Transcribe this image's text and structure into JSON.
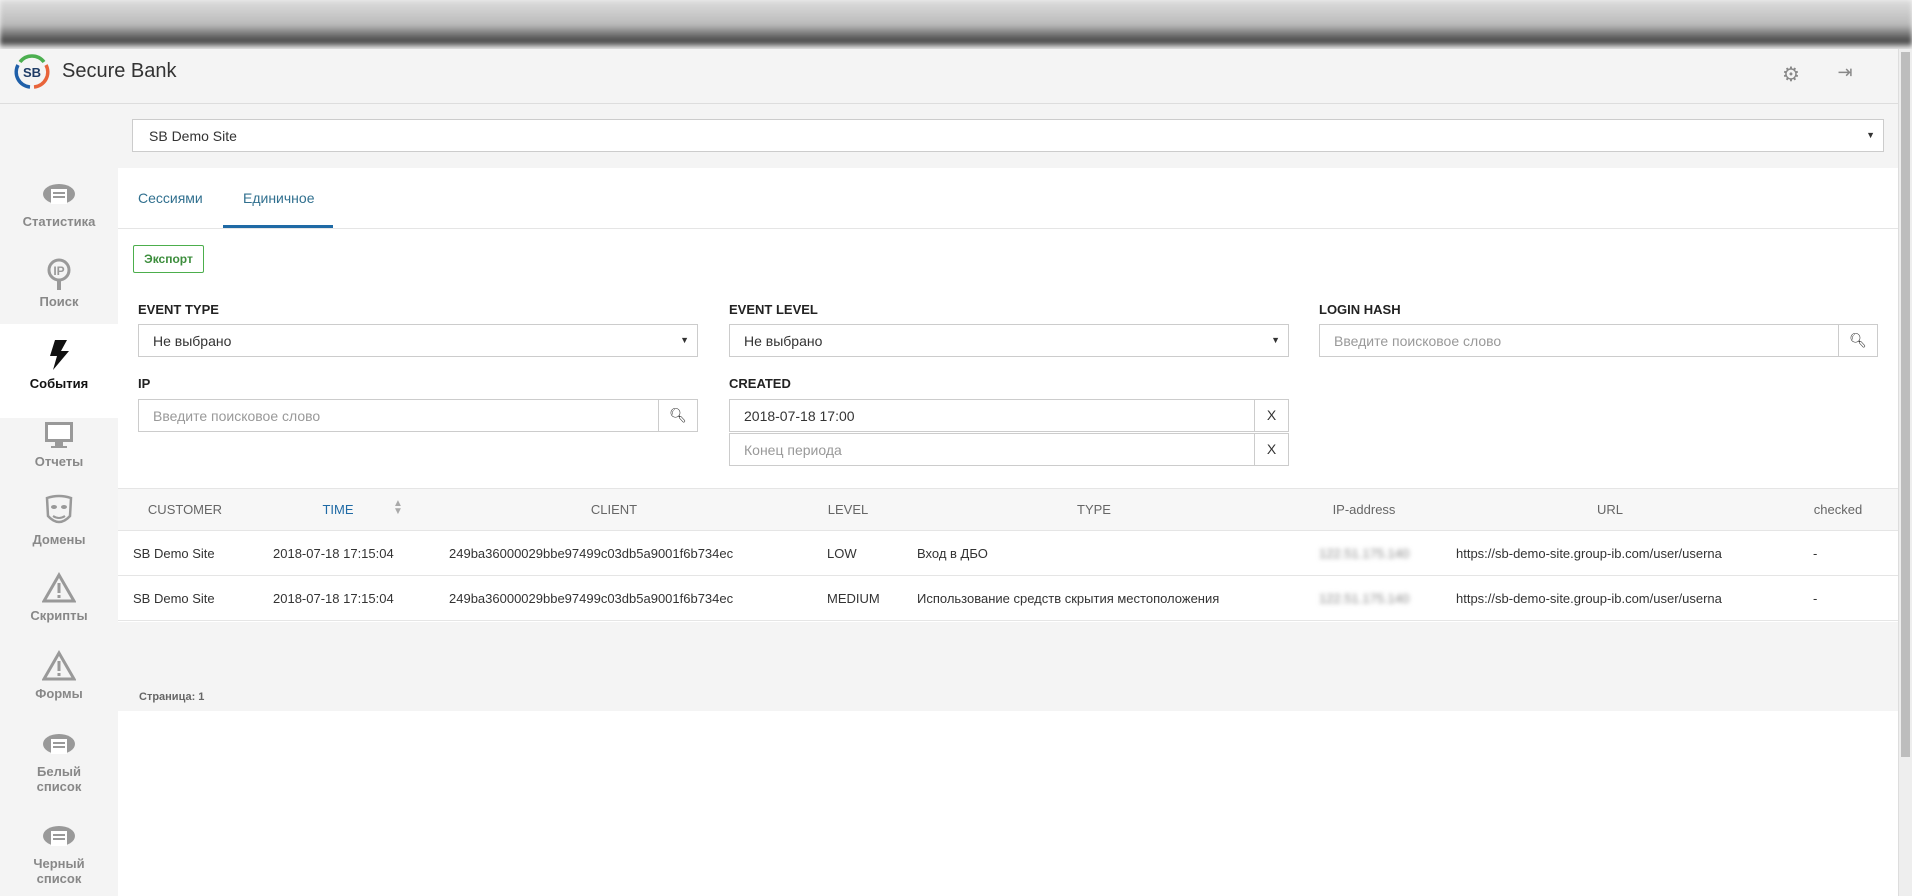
{
  "app": {
    "title": "Secure Bank",
    "logo_text": "SB"
  },
  "header": {
    "settings_icon": "gear-icon",
    "logout_icon": "exit-icon"
  },
  "sidebar": {
    "items": [
      {
        "label": "Статистика",
        "icon": "cloud-report-icon"
      },
      {
        "label": "Поиск",
        "icon": "ip-search-icon"
      },
      {
        "label": "События",
        "icon": "lightning-icon",
        "active": true
      },
      {
        "label": "Отчеты",
        "icon": "monitor-icon"
      },
      {
        "label": "Домены",
        "icon": "mask-icon"
      },
      {
        "label": "Скрипты",
        "icon": "warning-icon"
      },
      {
        "label": "Формы",
        "icon": "warning-icon"
      },
      {
        "label1": "Белый",
        "label2": "список",
        "icon": "cloud-list-icon"
      },
      {
        "label1": "Черный",
        "label2": "список",
        "icon": "cloud-list-icon"
      }
    ]
  },
  "site_select": {
    "value": "SB Demo Site"
  },
  "tabs": [
    {
      "label": "Сессиями"
    },
    {
      "label": "Единичное",
      "active": true
    }
  ],
  "export_label": "Экспорт",
  "filters": {
    "event_type": {
      "label": "EVENT TYPE",
      "value": "Не выбрано"
    },
    "event_level": {
      "label": "EVENT LEVEL",
      "value": "Не выбрано"
    },
    "login_hash": {
      "label": "LOGIN HASH",
      "placeholder": "Введите поисковое слово"
    },
    "ip": {
      "label": "IP",
      "placeholder": "Введите поисковое слово"
    },
    "created": {
      "label": "CREATED",
      "start": "2018-07-18 17:00",
      "end_placeholder": "Конец периода",
      "clear": "X"
    }
  },
  "table": {
    "columns": [
      "CUSTOMER",
      "TIME",
      "CLIENT",
      "LEVEL",
      "TYPE",
      "IP-address",
      "URL",
      "checked"
    ],
    "sorted_column": "TIME",
    "rows": [
      [
        "SB Demo Site",
        "2018-07-18 17:15:04",
        "249ba36000029bbe97499c03db5a9001f6b734ec",
        "LOW",
        "Вход в ДБО",
        "122.51.175.140",
        "https://sb-demo-site.group-ib.com/user/userna",
        "-"
      ],
      [
        "SB Demo Site",
        "2018-07-18 17:15:04",
        "249ba36000029bbe97499c03db5a9001f6b734ec",
        "MEDIUM",
        "Использование средств скрытия местоположения",
        "122.51.175.140",
        "https://sb-demo-site.group-ib.com/user/userna",
        "-"
      ]
    ]
  },
  "pager": "Страница: 1",
  "colors": {
    "accent": "#1f6aa5",
    "export": "#3c8d3c"
  }
}
